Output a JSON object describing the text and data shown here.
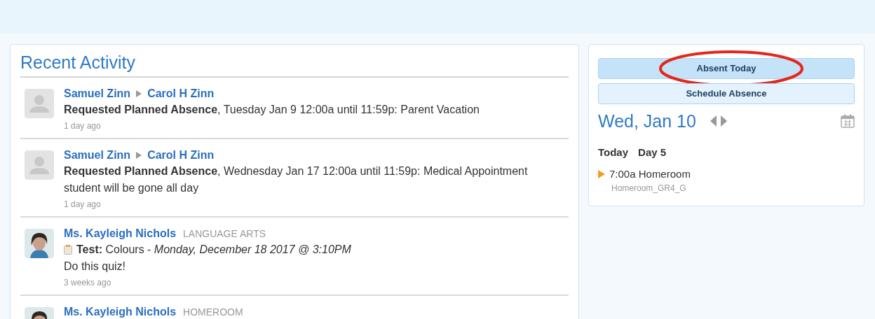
{
  "activity": {
    "title": "Recent Activity",
    "items": [
      {
        "avatar": {
          "kind": "placeholder"
        },
        "actor": "Samuel Zinn",
        "target": "Carol H Zinn",
        "lines": [
          "**Requested Planned Absence**, Tuesday Jan 9 12:00a until 11:59p: Parent Vacation"
        ],
        "time": "1 day ago"
      },
      {
        "avatar": {
          "kind": "placeholder"
        },
        "actor": "Samuel Zinn",
        "target": "Carol H Zinn",
        "lines": [
          "**Requested Planned Absence**, Wednesday Jan 17 12:00a until 11:59p: Medical Appointment",
          "student will be gone all day"
        ],
        "time": "1 day ago"
      },
      {
        "avatar": {
          "kind": "picture"
        },
        "actor": "Ms. Kayleigh Nichols",
        "subject": "LANGUAGE ARTS",
        "assignment": "**Test:** Colours - *Monday, December 18 2017 @ 3:10PM*",
        "lines": [
          "Do this quiz!"
        ],
        "time": "3 weeks ago"
      },
      {
        "avatar": {
          "kind": "picture"
        },
        "actor": "Ms. Kayleigh Nichols",
        "subject": "HOMEROOM"
      }
    ]
  },
  "attendance": {
    "buttons": [
      {
        "label": "Absent Today",
        "selected": true,
        "circled": true
      },
      {
        "label": "Schedule Absence",
        "selected": false,
        "circled": false
      }
    ],
    "date": "Wed, Jan 10",
    "day_label": "Today",
    "day_number": "Day 5",
    "schedule": [
      {
        "time_title": "7:00a Homeroom",
        "section": "Homeroom_GR4_G"
      }
    ]
  }
}
